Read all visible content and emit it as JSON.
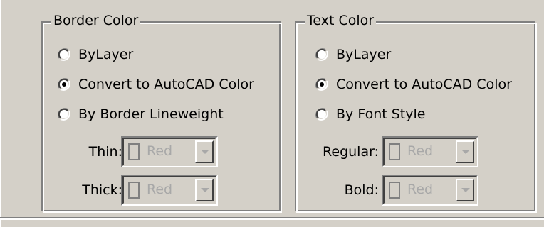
{
  "border_color": {
    "title": "Border Color",
    "options": [
      {
        "label": "ByLayer",
        "selected": false
      },
      {
        "label": "Convert to AutoCAD Color",
        "selected": true
      },
      {
        "label": "By Border Lineweight",
        "selected": false
      }
    ],
    "thin": {
      "label": "Thin:",
      "value": "Red"
    },
    "thick": {
      "label": "Thick:",
      "value": "Red"
    }
  },
  "text_color": {
    "title": "Text Color",
    "options": [
      {
        "label": "ByLayer",
        "selected": false
      },
      {
        "label": "Convert to AutoCAD Color",
        "selected": true
      },
      {
        "label": "By Font Style",
        "selected": false
      }
    ],
    "regular": {
      "label": "Regular:",
      "value": "Red"
    },
    "bold": {
      "label": "Bold:",
      "value": "Red"
    }
  },
  "colors": {
    "dialog_bg": "#d4d0c8",
    "disabled_text": "#a8a8a8"
  }
}
